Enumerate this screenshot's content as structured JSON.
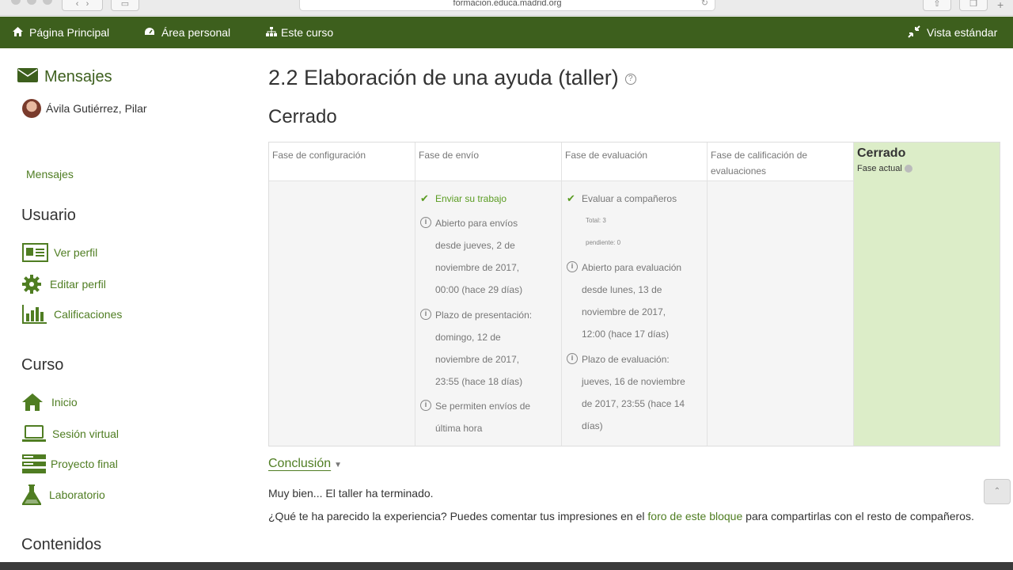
{
  "browser": {
    "url": "formacion.educa.madrid.org"
  },
  "navbar": {
    "home": "Página Principal",
    "personal": "Área personal",
    "course": "Este curso",
    "view": "Vista estándar"
  },
  "sidebar": {
    "messages_title": "Mensajes",
    "user_name": "Ávila Gutiérrez, Pilar",
    "messages_link": "Mensajes",
    "user_section": "Usuario",
    "user_items": [
      "Ver perfil",
      "Editar perfil",
      "Calificaciones"
    ],
    "course_section": "Curso",
    "course_items": [
      "Inicio",
      "Sesión virtual",
      "Proyecto final",
      "Laboratorio"
    ],
    "contents_section": "Contenidos"
  },
  "main": {
    "title": "2.2 Elaboración de una ayuda (taller)",
    "phase_status": "Cerrado",
    "phases": {
      "setup": {
        "label": "Fase de configuración"
      },
      "submission": {
        "label": "Fase de envío",
        "task": "Enviar su trabajo",
        "info1": [
          "Abierto para envíos",
          "desde jueves, 2 de",
          "noviembre de 2017,",
          "00:00 (hace 29 días)"
        ],
        "info2": [
          "Plazo de presentación:",
          "domingo, 12 de",
          "noviembre de 2017,",
          "23:55 (hace 18 días)"
        ],
        "info3": [
          "Se permiten envíos de",
          "última hora"
        ]
      },
      "assessment": {
        "label": "Fase de evaluación",
        "task": "Evaluar a compañeros",
        "total": "Total: 3",
        "pending": "pendiente: 0",
        "info1": [
          "Abierto para evaluación",
          "desde lunes, 13 de",
          "noviembre de 2017,",
          "12:00 (hace 17 días)"
        ],
        "info2": [
          "Plazo de evaluación:",
          "jueves, 16 de noviembre",
          "de 2017, 23:55 (hace 14",
          "días)"
        ]
      },
      "grading": {
        "label": "Fase de calificación de evaluaciones"
      },
      "closed": {
        "label": "Cerrado",
        "current": "Fase actual"
      }
    },
    "conclusion_title": "Conclusión",
    "conclusion_text1": "Muy bien... El taller ha terminado.",
    "conclusion_text2_before": "¿Qué te ha parecido la experiencia? Puedes comentar tus impresiones en el ",
    "conclusion_link": "foro de este bloque",
    "conclusion_text2_after": " para compartirlas con el resto de compañeros."
  }
}
